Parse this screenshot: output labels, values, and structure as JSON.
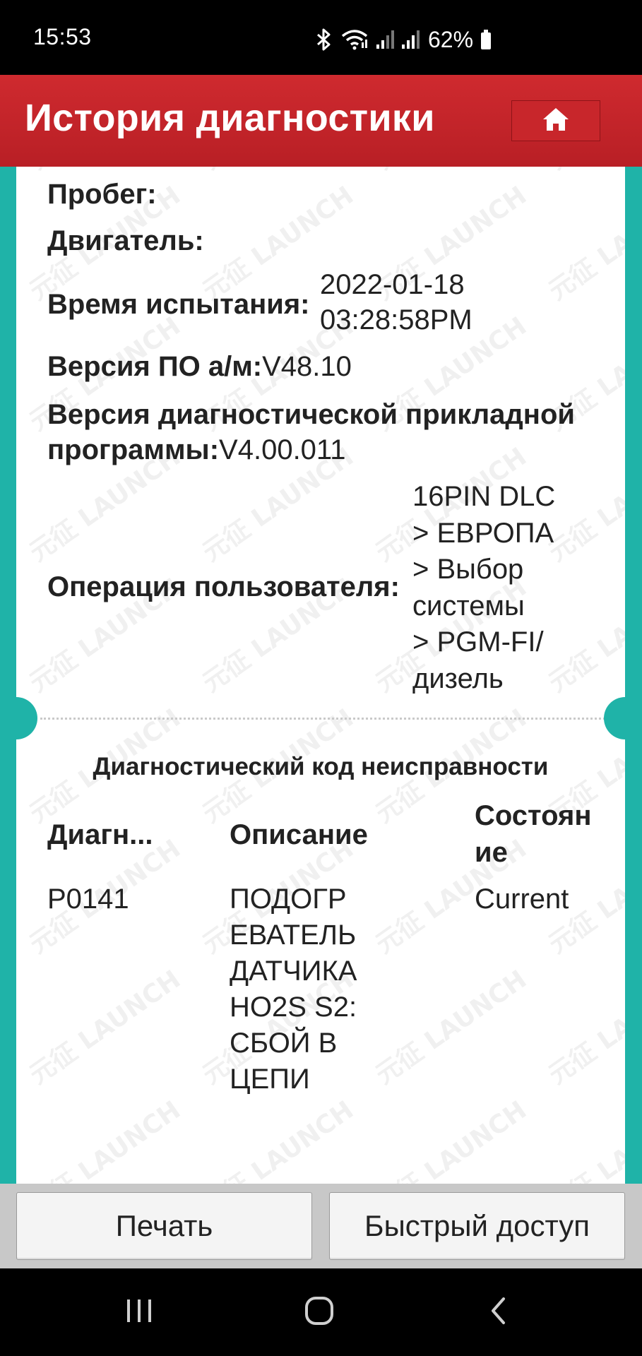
{
  "status_bar": {
    "time": "15:53",
    "battery_percent": "62%"
  },
  "header": {
    "title": "История диагностики"
  },
  "info": {
    "mileage_label": "Пробег:",
    "mileage_value": "",
    "engine_label": "Двигатель:",
    "engine_value": "",
    "test_time_label": "Время испытания:",
    "test_time_date": "2022-01-18",
    "test_time_clock": "03:28:58PM",
    "vehicle_sw_label": "Версия ПО а/м:",
    "vehicle_sw_value": "V48.10",
    "app_version_label_line1": "Версия диагностической прикладной",
    "app_version_label_line2": "программы:",
    "app_version_value": "V4.00.011",
    "user_op_label": "Операция пользователя:",
    "user_op_lines": [
      "16PIN DLC",
      "> ЕВРОПА",
      "> Выбор",
      "системы",
      "> PGM-FI/",
      "дизель"
    ]
  },
  "dtc": {
    "section_title": "Диагностический код неисправности",
    "columns": {
      "code": "Диагн...",
      "description": "Описание",
      "status_line1": "Состоян",
      "status_line2": "ие"
    },
    "rows": [
      {
        "code": "P0141",
        "description_lines": [
          "ПОДОГР",
          "ЕВАТЕЛЬ",
          "ДАТЧИКА",
          "HO2S S2:",
          "СБОЙ В",
          "ЦЕПИ"
        ],
        "status": "Current"
      }
    ]
  },
  "watermark": {
    "text": "元征 LAUNCH"
  },
  "bottom_bar": {
    "print_label": "Печать",
    "shortcut_label": "Быстрый доступ"
  },
  "colors": {
    "header_red": "#c8262b",
    "teal": "#1fb3a8"
  },
  "icons": {
    "home": "home-icon",
    "bluetooth": "bluetooth-icon",
    "wifi": "wifi-icon",
    "signal": "signal-icon",
    "battery": "battery-icon",
    "nav_recent": "recent-apps-icon",
    "nav_home": "nav-home-icon",
    "nav_back": "back-icon"
  }
}
